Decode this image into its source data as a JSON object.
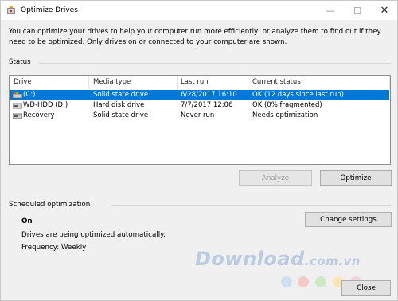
{
  "window": {
    "title": "Optimize Drives",
    "minimize_icon": "—",
    "maximize_icon": "☐",
    "close_icon": "✕"
  },
  "description": "You can optimize your drives to help your computer run more efficiently, or analyze them to find out if they need to be optimized. Only drives on or connected to your computer are shown.",
  "status": {
    "heading": "Status",
    "columns": [
      "Drive",
      "Media type",
      "Last run",
      "Current status"
    ],
    "rows": [
      {
        "drive": "(C:)",
        "media": "Solid state drive",
        "last_run": "6/28/2017 16:10",
        "status": "OK (12 days since last run)",
        "selected": true,
        "icon": "system-drive-icon"
      },
      {
        "drive": "WD-HDD (D:)",
        "media": "Hard disk drive",
        "last_run": "7/7/2017 12:06",
        "status": "OK (0% fragmented)",
        "selected": false,
        "icon": "hard-drive-icon"
      },
      {
        "drive": "Recovery",
        "media": "Solid state drive",
        "last_run": "Never run",
        "status": "Needs optimization",
        "selected": false,
        "icon": "hard-drive-icon"
      }
    ],
    "analyze_label": "Analyze",
    "optimize_label": "Optimize"
  },
  "scheduled": {
    "heading": "Scheduled optimization",
    "state": "On",
    "info": "Drives are being optimized automatically.",
    "frequency": "Frequency: Weekly",
    "change_label": "Change settings"
  },
  "close_label": "Close",
  "watermark": {
    "text": "Download",
    "suffix": ".com.vn",
    "dot_colors": [
      "#cfe0f3",
      "#f5c9c7",
      "#cfe8c6",
      "#fbe4b5",
      "#f7d0d9",
      "#c9def5"
    ]
  },
  "colors": {
    "selection": "#0078d7",
    "window_bg": "#f0f0f0"
  }
}
